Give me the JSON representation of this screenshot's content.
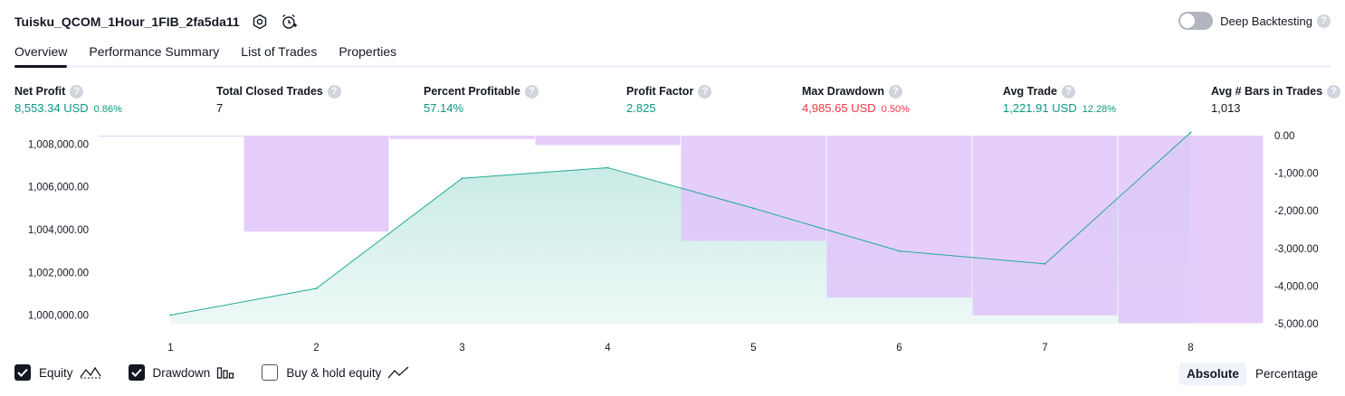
{
  "header": {
    "title": "Tuisku_QCOM_1Hour_1FIB_2fa5da11",
    "icons": [
      "settings-icon",
      "add-alert-icon"
    ],
    "deep_backtesting_label": "Deep Backtesting",
    "deep_backtesting_enabled": false,
    "help_glyph": "?"
  },
  "tabs": [
    {
      "label": "Overview",
      "active": true
    },
    {
      "label": "Performance Summary",
      "active": false
    },
    {
      "label": "List of Trades",
      "active": false
    },
    {
      "label": "Properties",
      "active": false
    }
  ],
  "metrics": [
    {
      "label": "Net Profit",
      "value": "8,553.34 USD",
      "pct": "0.86%",
      "tone": "green"
    },
    {
      "label": "Total Closed Trades",
      "value": "7",
      "pct": "",
      "tone": "dark"
    },
    {
      "label": "Percent Profitable",
      "value": "57.14%",
      "pct": "",
      "tone": "green"
    },
    {
      "label": "Profit Factor",
      "value": "2.825",
      "pct": "",
      "tone": "green"
    },
    {
      "label": "Max Drawdown",
      "value": "4,985.65 USD",
      "pct": "0.50%",
      "tone": "red"
    },
    {
      "label": "Avg Trade",
      "value": "1,221.91 USD",
      "pct": "12.28%",
      "tone": "green"
    },
    {
      "label": "Avg # Bars in Trades",
      "value": "1,013",
      "pct": "",
      "tone": "dark"
    }
  ],
  "chart_data": {
    "type": "line",
    "x": [
      1,
      2,
      3,
      4,
      5,
      6,
      7,
      8
    ],
    "x_tick_labels": [
      "1",
      "2",
      "3",
      "4",
      "5",
      "6",
      "7",
      "8"
    ],
    "series": [
      {
        "name": "Equity",
        "kind": "area-line",
        "axis": "left",
        "color": "#22ab94",
        "values": [
          1000000,
          1001250,
          1006400,
          1006900,
          1005000,
          1003000,
          1002400,
          1008550
        ]
      },
      {
        "name": "Drawdown",
        "kind": "bar",
        "axis": "right",
        "color": "#e1c4fc",
        "values": [
          0,
          -2550,
          -90,
          -250,
          -2800,
          -4300,
          -4780,
          -4985.65
        ]
      }
    ],
    "left_axis": {
      "ylim": [
        999600,
        1008400
      ],
      "ticks": [
        1000000,
        1002000,
        1004000,
        1006000,
        1008000
      ],
      "tick_labels": [
        "1,000,000.00",
        "1,002,000.00",
        "1,004,000.00",
        "1,006,000.00",
        "1,008,000.00"
      ]
    },
    "right_axis": {
      "ylim": [
        -5000,
        0
      ],
      "ticks": [
        0,
        -1000,
        -2000,
        -3000,
        -4000,
        -5000
      ],
      "tick_labels": [
        "0.00",
        "-1,000.00",
        "-2,000.00",
        "-3,000.00",
        "-4,000.00",
        "-5,000.00"
      ]
    },
    "grid": false
  },
  "legend": [
    {
      "label": "Equity",
      "checked": true,
      "icon": "equity-line-icon"
    },
    {
      "label": "Drawdown",
      "checked": true,
      "icon": "drawdown-bars-icon"
    },
    {
      "label": "Buy & hold equity",
      "checked": false,
      "icon": "buy-hold-line-icon"
    }
  ],
  "view_mode": {
    "options": [
      "Absolute",
      "Percentage"
    ],
    "selected": "Absolute"
  }
}
